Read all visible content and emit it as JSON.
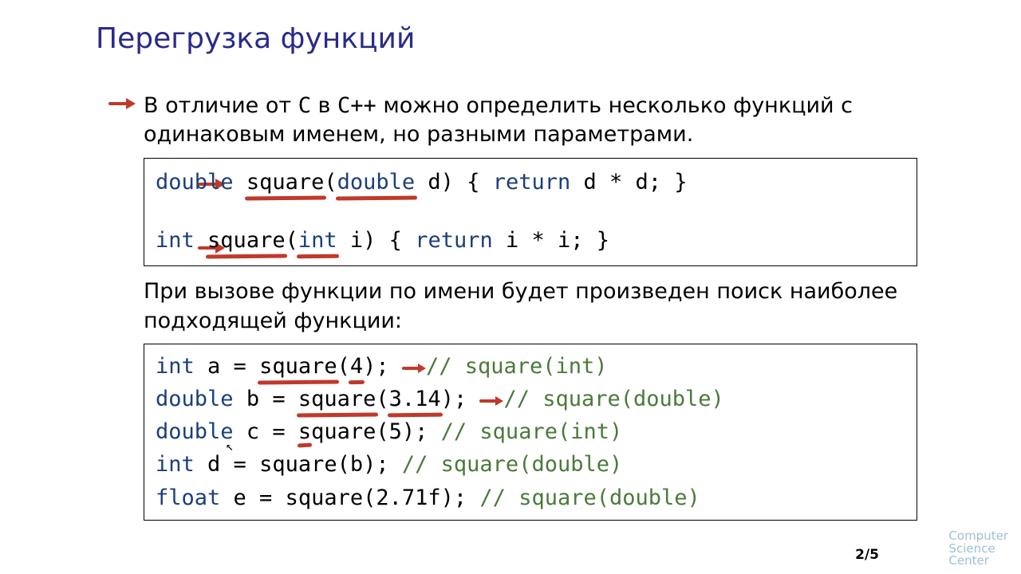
{
  "title": "Перегрузка функций",
  "bullet1_pre": "В отличие от ",
  "bullet1_c": "C",
  "bullet1_mid": " в ",
  "bullet1_cpp": "C++",
  "bullet1_post": " можно определить несколько функций с одинаковым именем, но разными параметрами.",
  "code1": {
    "l1": {
      "t1": "double",
      "t2": "square",
      "t3": "(",
      "t4": "double",
      "t5": " d) { ",
      "t6": "return",
      "t7": " d * d; }"
    },
    "l2": {
      "t1": "int",
      "pad1": "    ",
      "t2": "square",
      "t3": "(",
      "t4": "int",
      "pad2": "    ",
      "t5": "i) { ",
      "t6": "return",
      "t7": " i * i; }"
    }
  },
  "para2": "При вызове функции по имени будет произведен поиск наиболее подходящей функции:",
  "code2": {
    "l1": {
      "t1": "int",
      "p1": "    ",
      "t2": "a = ",
      "t3": "square",
      "t4": "(",
      "t5": "4",
      "t6": ");",
      "p2": "      ",
      "c": "// square(int)"
    },
    "l2": {
      "t1": "double",
      "p1": " ",
      "t2": "b = ",
      "t3": "square",
      "t4": "(",
      "t5": "3.14",
      "t6": ");",
      "p2": "  ",
      "c": "// square(double)"
    },
    "l3": {
      "t1": "double",
      "p1": " ",
      "t2": "c = square(5);",
      "p2": "     ",
      "c": "// square(int)"
    },
    "l4": {
      "t1": "int",
      "p1": "    ",
      "t2": "d = square(b);",
      "p2": "     ",
      "c": "// square(double)"
    },
    "l5": {
      "t1": "float",
      "p1": "  ",
      "t2": "e = square(2.71f);",
      "p2": " ",
      "c": "// square(double)"
    }
  },
  "page": "2/5",
  "logo": {
    "l1": "Computer",
    "l2": "Science",
    "l3": "Center"
  }
}
